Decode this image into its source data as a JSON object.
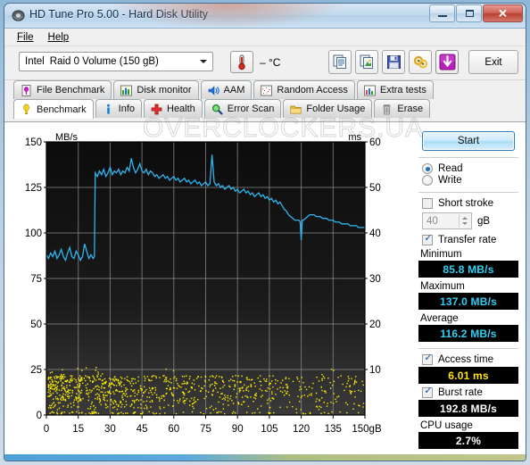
{
  "window": {
    "title": "HD Tune Pro 5.00 - Hard Disk Utility",
    "icon": "disk-icon",
    "minimize_label": "—",
    "maximize_label": "□",
    "close_label": "✕"
  },
  "menu": {
    "items": [
      {
        "label": "File",
        "accel": "F"
      },
      {
        "label": "Help",
        "accel": "H"
      }
    ]
  },
  "toolbar": {
    "drive": {
      "vendor": "Intel",
      "model": "Raid 0 Volume (150 gB)"
    },
    "temperature": "–  °C",
    "temperature_icon": "thermometer-icon",
    "buttons": [
      {
        "name": "copy-text-button",
        "icon": "copy-text-icon"
      },
      {
        "name": "copy-image-button",
        "icon": "copy-image-icon"
      },
      {
        "name": "save-button",
        "icon": "floppy-disk-icon"
      },
      {
        "name": "settings-button",
        "icon": "gear-gold-icon"
      },
      {
        "name": "download-button",
        "icon": "download-arrow-icon"
      }
    ],
    "exit_label": "Exit"
  },
  "tabs": {
    "row1": [
      {
        "label": "File Benchmark",
        "icon": "file-benchmark-icon",
        "active": false
      },
      {
        "label": "Disk monitor",
        "icon": "bar-chart-icon",
        "active": false
      },
      {
        "label": "AAM",
        "icon": "speaker-icon",
        "active": false
      },
      {
        "label": "Random Access",
        "icon": "random-access-icon",
        "active": false
      },
      {
        "label": "Extra tests",
        "icon": "extra-tests-icon",
        "active": false
      }
    ],
    "row2": [
      {
        "label": "Benchmark",
        "icon": "bulb-icon",
        "active": true
      },
      {
        "label": "Info",
        "icon": "info-icon",
        "active": false
      },
      {
        "label": "Health",
        "icon": "health-cross-icon",
        "active": false
      },
      {
        "label": "Error Scan",
        "icon": "magnifier-icon",
        "active": false
      },
      {
        "label": "Folder Usage",
        "icon": "folder-icon",
        "active": false
      },
      {
        "label": "Erase",
        "icon": "trash-icon",
        "active": false
      }
    ]
  },
  "watermark": "OVERCLOCKERS.UA",
  "panel": {
    "start_label": "Start",
    "mode": {
      "read_label": "Read",
      "write_label": "Write",
      "selected": "Read"
    },
    "short_stroke": {
      "label": "Short stroke",
      "checked": false,
      "value": "40",
      "unit": "gB"
    },
    "transfer_rate": {
      "label": "Transfer rate",
      "checked": true
    },
    "minimum": {
      "label": "Minimum",
      "value": "85.8 MB/s"
    },
    "maximum": {
      "label": "Maximum",
      "value": "137.0 MB/s"
    },
    "average": {
      "label": "Average",
      "value": "116.2 MB/s"
    },
    "access_time": {
      "label": "Access time",
      "checked": true,
      "value": "6.01 ms"
    },
    "burst_rate": {
      "label": "Burst rate",
      "checked": true,
      "value": "192.8 MB/s"
    },
    "cpu_usage": {
      "label": "CPU usage",
      "value": "2.7%"
    }
  },
  "chart_data": {
    "type": "line",
    "title": "",
    "xlabel": "gB",
    "ylabel": "MB/s",
    "y2label": "ms",
    "xlim": [
      0,
      150
    ],
    "ylim": [
      0,
      150
    ],
    "y2lim": [
      0,
      60
    ],
    "xticks": [
      0,
      15,
      30,
      45,
      60,
      75,
      90,
      105,
      120,
      135,
      150
    ],
    "xtick_labels": [
      "0",
      "15",
      "30",
      "45",
      "60",
      "75",
      "90",
      "105",
      "120",
      "135",
      "150gB"
    ],
    "yticks": [
      0,
      25,
      50,
      75,
      100,
      125,
      150
    ],
    "ytick_labels": [
      "0",
      "25",
      "50",
      "75",
      "100",
      "125",
      "150"
    ],
    "y2ticks": [
      10,
      20,
      30,
      40,
      50,
      60
    ],
    "y2tick_labels": [
      "10",
      "20",
      "30",
      "40",
      "50",
      "60"
    ],
    "grid": true,
    "background": "#101010",
    "series": [
      {
        "name": "Transfer rate",
        "type": "line",
        "color": "#2fb4ef",
        "axis": "left",
        "units": "MB/s",
        "x": [
          0,
          1,
          2,
          3,
          4,
          5,
          6,
          7,
          8,
          9,
          10,
          11,
          12,
          13,
          14,
          15,
          16,
          17,
          18,
          19,
          20,
          21,
          22,
          22.6,
          23,
          24,
          25,
          26,
          27,
          28,
          29,
          30,
          31,
          32,
          33,
          34,
          35,
          36,
          37,
          38,
          39,
          40,
          41,
          42,
          43,
          44,
          45,
          46,
          47,
          48,
          49,
          50,
          51,
          52,
          53,
          54,
          55,
          56,
          57,
          58,
          59,
          60,
          61,
          62,
          63,
          64,
          65,
          66,
          67,
          68,
          69,
          70,
          71,
          72,
          73,
          74,
          75,
          76,
          77,
          78,
          79,
          80,
          81,
          82,
          83,
          84,
          85,
          86,
          87,
          88,
          89,
          90,
          91,
          92,
          93,
          94,
          95,
          96,
          97,
          98,
          99,
          100,
          101,
          102,
          103,
          104,
          105,
          106,
          107,
          108,
          109,
          110,
          111,
          112,
          113,
          114,
          115,
          116,
          117,
          118,
          119,
          119.5,
          120,
          120.5,
          121,
          122,
          123,
          124,
          125,
          126,
          127,
          128,
          129,
          130,
          131,
          132,
          133,
          134,
          135,
          136,
          137,
          138,
          139,
          140,
          141,
          142,
          143,
          144,
          145,
          146,
          147,
          148,
          149,
          150
        ],
        "y": [
          88,
          86,
          89,
          87,
          90,
          86,
          88,
          91,
          87,
          85,
          89,
          92,
          87,
          86,
          90,
          88,
          85,
          87,
          94,
          90,
          86,
          88,
          86,
          87,
          133,
          131,
          134,
          132,
          135,
          131,
          133,
          136,
          132,
          134,
          133,
          135,
          132,
          134,
          133,
          136,
          134,
          141,
          136,
          133,
          135,
          138,
          134,
          133,
          135,
          132,
          134,
          133,
          131,
          132,
          130,
          131,
          132,
          130,
          131,
          129,
          130,
          131,
          129,
          130,
          128,
          129,
          130,
          128,
          129,
          127,
          128,
          129,
          127,
          128,
          126,
          127,
          128,
          126,
          127,
          143,
          128,
          126,
          127,
          125,
          126,
          124,
          125,
          126,
          124,
          125,
          123,
          124,
          122,
          123,
          124,
          122,
          123,
          121,
          122,
          120,
          121,
          122,
          120,
          121,
          119,
          120,
          118,
          119,
          117,
          118,
          116,
          117,
          115,
          113,
          112,
          110,
          109,
          108,
          107,
          107,
          107,
          106,
          96,
          107,
          107,
          108,
          109,
          110,
          110,
          110,
          109,
          109,
          109,
          108,
          108,
          108,
          107,
          107,
          107,
          106,
          106,
          106,
          105,
          105,
          105,
          105,
          104,
          104,
          104,
          104,
          103,
          103,
          103,
          103,
          102
        ]
      },
      {
        "name": "Access time",
        "type": "scatter",
        "color": "#ffee00",
        "axis": "right",
        "units": "ms",
        "mean": 6.01,
        "description": "Dense yellow scatter of per-sample access times, mostly 1-9 ms, densest at the left of the span"
      }
    ]
  }
}
